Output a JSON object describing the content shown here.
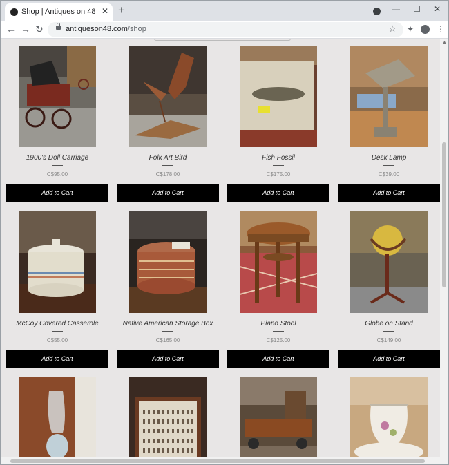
{
  "browser": {
    "tab_title": "Shop | Antiques on 48",
    "tab_close": "✕",
    "new_tab": "+",
    "window_minimize": "—",
    "window_maximize": "☐",
    "window_close": "✕",
    "back": "←",
    "forward": "→",
    "reload": "↻",
    "url_host": "antiqueson48.com",
    "url_path": "/shop",
    "bookmark": "☆",
    "extensions": "✦",
    "menu": "⋮"
  },
  "products": [
    {
      "name": "1900's Doll Carriage",
      "price": "C$95.00",
      "button": "Add to Cart"
    },
    {
      "name": "Folk Art Bird",
      "price": "C$178.00",
      "button": "Add to Cart"
    },
    {
      "name": "Fish Fossil",
      "price": "C$175.00",
      "button": "Add to Cart"
    },
    {
      "name": "Desk Lamp",
      "price": "C$39.00",
      "button": "Add to Cart"
    },
    {
      "name": "McCoy Covered Casserole",
      "price": "C$55.00",
      "button": "Add to Cart"
    },
    {
      "name": "Native American Storage Box",
      "price": "C$165.00",
      "button": "Add to Cart"
    },
    {
      "name": "Piano Stool",
      "price": "C$125.00",
      "button": "Add to Cart"
    },
    {
      "name": "Globe on Stand",
      "price": "C$149.00",
      "button": "Add to Cart"
    }
  ],
  "colors": {
    "page_bg": "#e8e6e6",
    "button_bg": "#000000",
    "button_text": "#ffffff"
  }
}
